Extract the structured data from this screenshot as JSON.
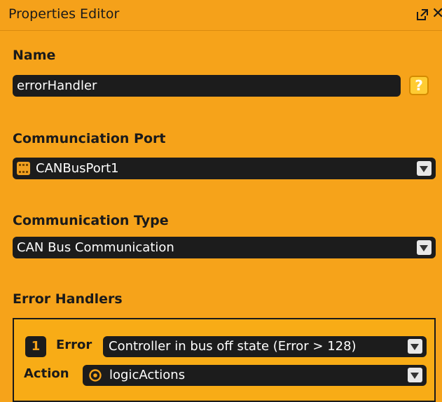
{
  "panel": {
    "title": "Properties Editor",
    "popout_icon": "popout-icon",
    "close_glyph": "✕"
  },
  "name": {
    "label": "Name",
    "value": "errorHandler",
    "help_glyph": "?"
  },
  "communication_port": {
    "label": "Communciation Port",
    "value": "CANBusPort1",
    "icon": "port-icon"
  },
  "communication_type": {
    "label": "Communication Type",
    "value": "CAN Bus Communication"
  },
  "error_handlers": {
    "label": "Error Handlers",
    "items": [
      {
        "number": "1",
        "error_label": "Error",
        "error_value": "Controller in bus off state (Error > 128)",
        "action_label": "Action",
        "action_value": "logicActions",
        "action_icon": "gear-icon"
      }
    ]
  },
  "colors": {
    "panel_bg": "#f6a31a",
    "field_bg": "#1c1c1c",
    "help_bg": "#ffcc33"
  }
}
